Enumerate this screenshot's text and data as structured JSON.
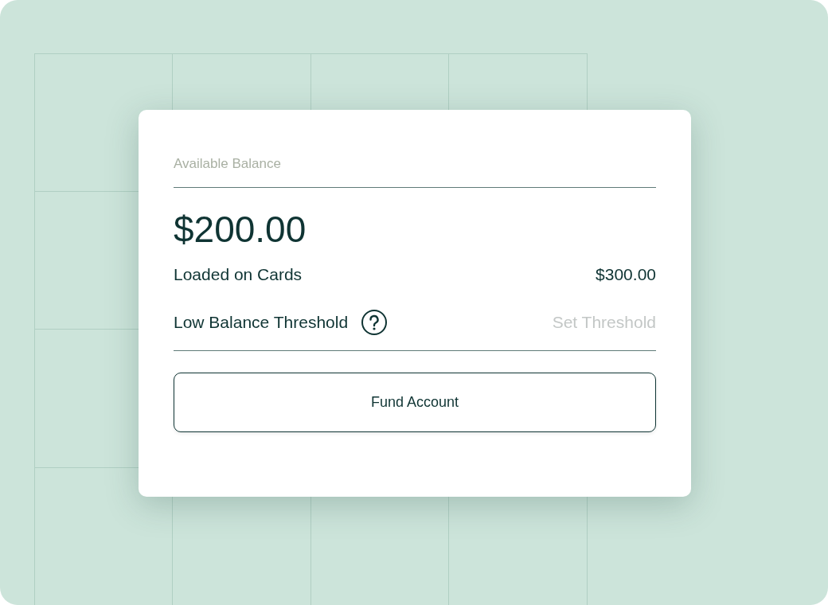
{
  "card": {
    "heading": "Available Balance",
    "balance": "$200.00",
    "rows": [
      {
        "kind": "value",
        "label": "Loaded on Cards",
        "value": "$300.00",
        "help": false
      },
      {
        "kind": "action",
        "label": "Low Balance Threshold",
        "value": "Set Threshold",
        "help": true
      }
    ],
    "button": "Fund Account"
  }
}
